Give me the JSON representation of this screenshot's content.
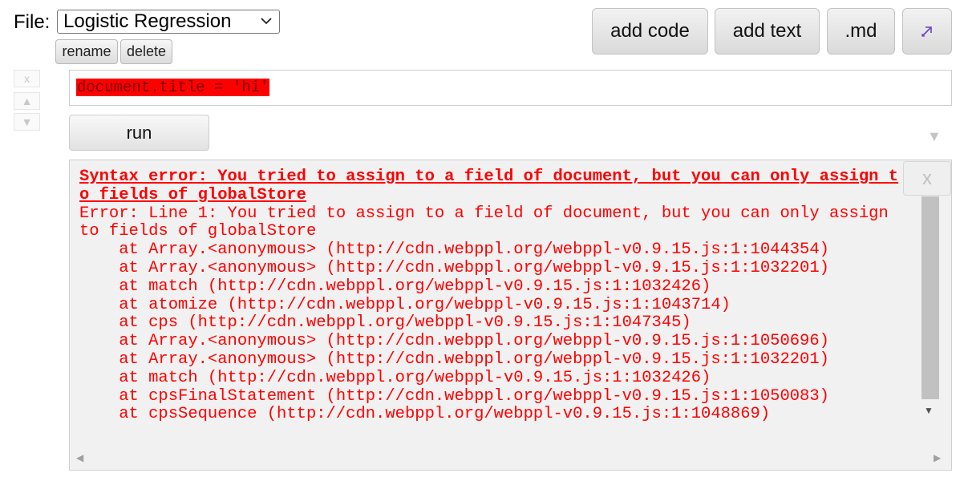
{
  "file": {
    "label": "File:",
    "selected": "Logistic Regression",
    "rename_label": "rename",
    "delete_label": "delete"
  },
  "toolbar": {
    "add_code_label": "add code",
    "add_text_label": "add text",
    "md_label": ".md",
    "expand_icon": "expand-arrow-icon"
  },
  "cell": {
    "close_label": "x",
    "up_label": "▲",
    "down_label": "▼",
    "code": "document.title = 'hi'",
    "run_label": "run",
    "collapse_label": "▼"
  },
  "output": {
    "close_label": "x",
    "error_heading_1": "Syntax error: You tried to assign to a field of document, but you can only assign t",
    "error_heading_2": "o fields of globalStore",
    "error_line_1": "Error: Line 1: You tried to assign to a field of document, but you can only assign",
    "error_line_2": "to fields of globalStore",
    "stack": [
      "    at Array.<anonymous> (http://cdn.webppl.org/webppl-v0.9.15.js:1:1044354)",
      "    at Array.<anonymous> (http://cdn.webppl.org/webppl-v0.9.15.js:1:1032201)",
      "    at match (http://cdn.webppl.org/webppl-v0.9.15.js:1:1032426)",
      "    at atomize (http://cdn.webppl.org/webppl-v0.9.15.js:1:1043714)",
      "    at cps (http://cdn.webppl.org/webppl-v0.9.15.js:1:1047345)",
      "    at Array.<anonymous> (http://cdn.webppl.org/webppl-v0.9.15.js:1:1050696)",
      "    at Array.<anonymous> (http://cdn.webppl.org/webppl-v0.9.15.js:1:1032201)",
      "    at match (http://cdn.webppl.org/webppl-v0.9.15.js:1:1032426)",
      "    at cpsFinalStatement (http://cdn.webppl.org/webppl-v0.9.15.js:1:1050083)",
      "    at cpsSequence (http://cdn.webppl.org/webppl-v0.9.15.js:1:1048869)"
    ]
  },
  "scroll": {
    "up_arrow": "▲",
    "down_arrow": "▼",
    "left_arrow": "◀",
    "right_arrow": "▶"
  },
  "colors": {
    "error": "#ff0000",
    "code_highlight": "#ff0000",
    "icon_purple": "#6a3fc0"
  }
}
